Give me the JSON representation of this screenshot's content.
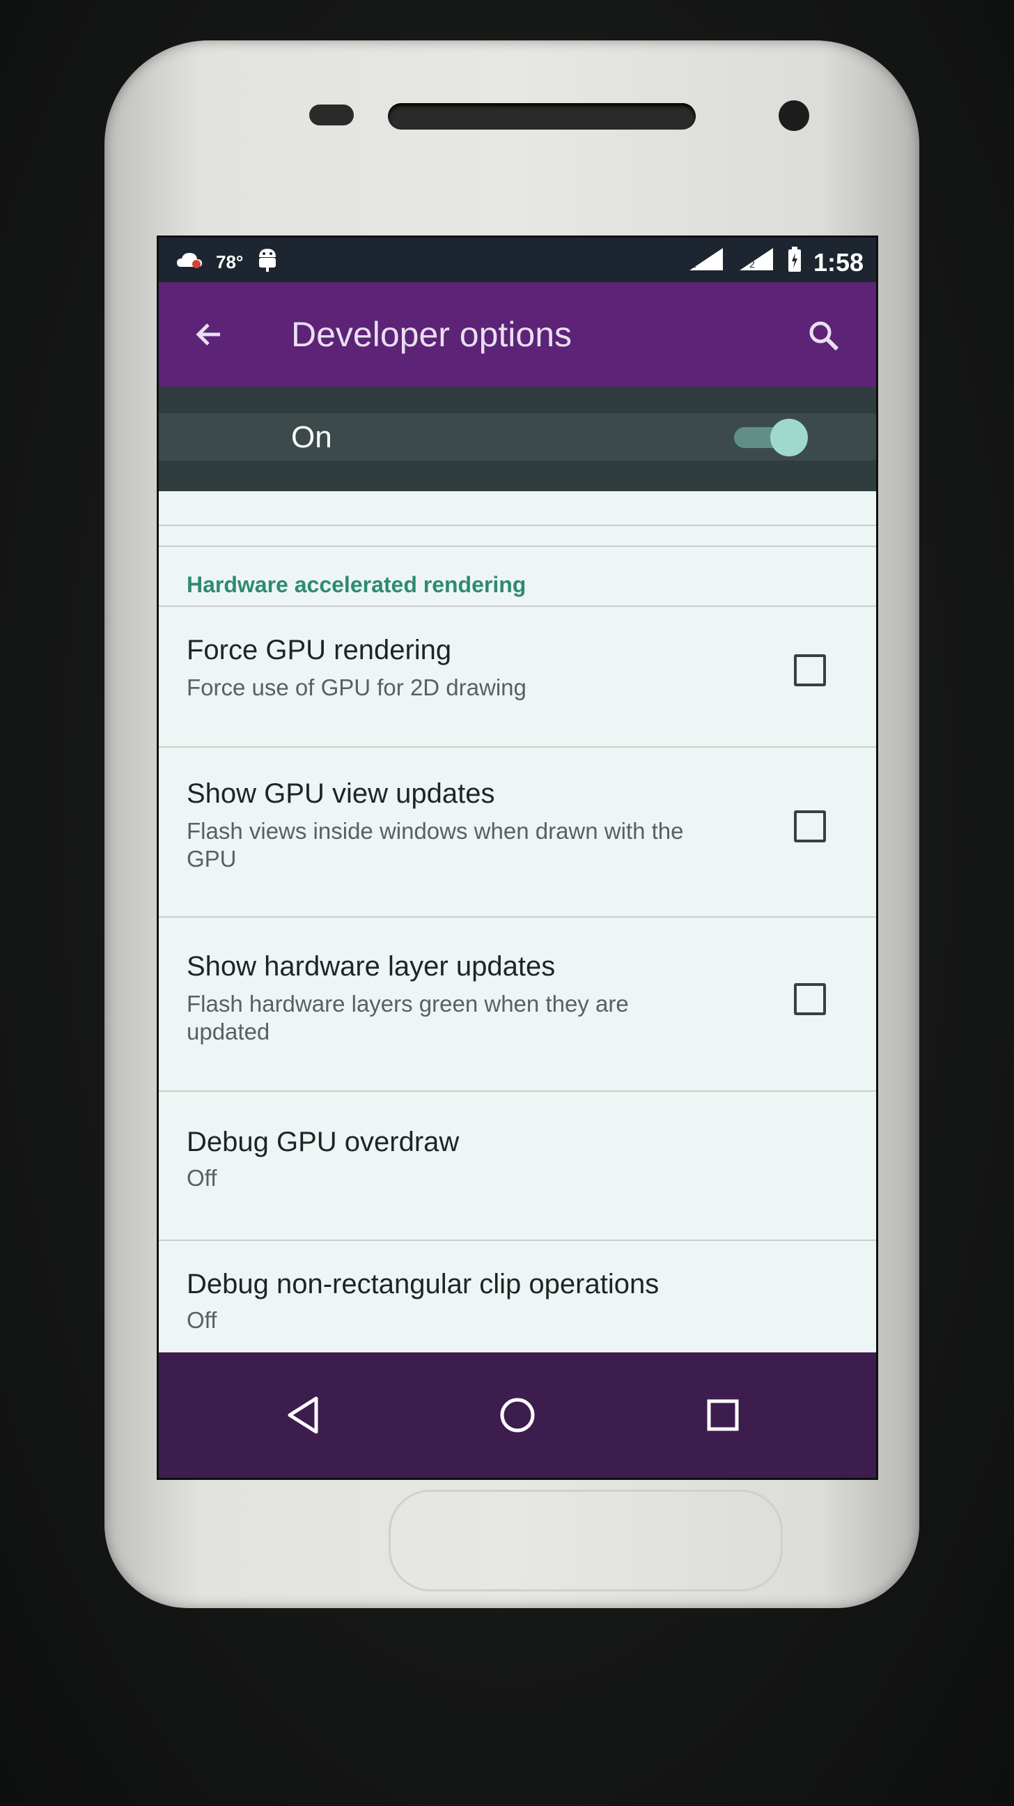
{
  "status_bar": {
    "temperature": "78°",
    "time": "1:58",
    "left_icons": [
      "cloud-icon",
      "android-debug-icon"
    ],
    "right_icons": [
      "signal-icon",
      "signal-icon",
      "battery-icon"
    ]
  },
  "toolbar": {
    "title": "Developer options",
    "back_icon": "arrow-left-icon",
    "search_icon": "search-icon"
  },
  "master_switch": {
    "label": "On",
    "state": "on"
  },
  "section": {
    "header": "Hardware accelerated rendering"
  },
  "items": [
    {
      "title": "Force GPU rendering",
      "summary": "Force use of GPU for 2D drawing",
      "checkbox": false
    },
    {
      "title": "Show GPU view updates",
      "summary": "Flash views inside windows when drawn with the GPU",
      "checkbox": false
    },
    {
      "title": "Show hardware layer updates",
      "summary": "Flash hardware layers green when they are updated",
      "checkbox": false
    },
    {
      "title": "Debug GPU overdraw",
      "summary": "Off"
    },
    {
      "title": "Debug non-rectangular clip operations",
      "summary": "Off"
    }
  ],
  "nav_bar": {
    "buttons": [
      "back-icon",
      "home-icon",
      "recents-icon"
    ]
  },
  "colors": {
    "toolbar": "#5c2377",
    "accent": "#2f8a72",
    "navbar": "#3c1d4d"
  }
}
